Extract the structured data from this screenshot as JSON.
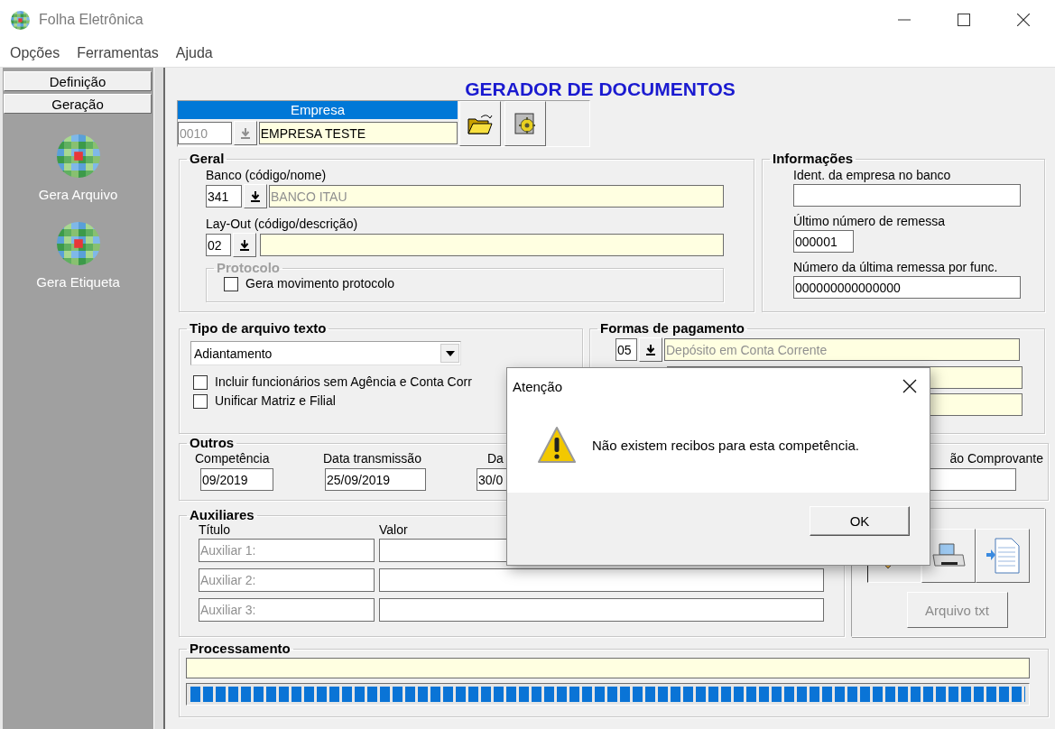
{
  "window": {
    "title": "Folha Eletrônica"
  },
  "menu": [
    {
      "label": "Opções"
    },
    {
      "label": "Ferramentas"
    },
    {
      "label": "Ajuda"
    }
  ],
  "sidebar": {
    "tabs": [
      {
        "label": "Definição"
      },
      {
        "label": "Geração"
      }
    ],
    "items": [
      {
        "label": "Gera Arquivo"
      },
      {
        "label": "Gera Etiqueta"
      }
    ]
  },
  "form": {
    "title": "GERADOR DE DOCUMENTOS",
    "empresa": {
      "label": "Empresa",
      "code": "0010",
      "name": "EMPRESA TESTE"
    },
    "geral": {
      "title": "Geral",
      "banco": {
        "label": "Banco (código/nome)",
        "code": "341",
        "name": "BANCO ITAU"
      },
      "layout": {
        "label": "Lay-Out (código/descrição)",
        "code": "02"
      },
      "protocolo": {
        "title": "Protocolo",
        "disabled": true,
        "option": {
          "label": "Gera movimento protocolo",
          "checked": false
        }
      }
    },
    "informacoes": {
      "title": "Informações",
      "fields": [
        {
          "label": "Ident. da empresa no banco"
        },
        {
          "label": "Último número de remessa",
          "value": "000001"
        },
        {
          "label": "Número da última remessa por func.",
          "value": "000000000000000"
        }
      ]
    },
    "tipo": {
      "title": "Tipo de arquivo texto",
      "select": "Adiantamento",
      "options": [
        {
          "label": "Incluir funcionários sem Agência e Conta Corr",
          "checked": false
        },
        {
          "label": "Unificar Matriz e Filial",
          "checked": false
        }
      ]
    },
    "formas": {
      "title": "Formas de pagamento",
      "rows": [
        {
          "code": "05",
          "description": "Depósito em Conta Corrente"
        },
        {
          "kind": "empty"
        },
        {
          "kind": "empty"
        }
      ]
    },
    "outros": {
      "title": "Outros",
      "fields": [
        {
          "label": "Competência",
          "value": "09/2019"
        },
        {
          "label": "Data transmissão",
          "value": "25/09/2019"
        },
        {
          "label": "Da",
          "value": "30/0"
        },
        {
          "label": "ão Comprovante"
        }
      ]
    },
    "auxiliares": {
      "title": "Auxiliares",
      "columns": [
        "Título",
        "Valor"
      ],
      "rows": [
        {
          "title": "Auxiliar 1:"
        },
        {
          "title": "Auxiliar 2:"
        },
        {
          "title": "Auxiliar 3:"
        }
      ]
    },
    "actions": {
      "export_button": {
        "label": "Arquivo txt",
        "disabled": true
      }
    },
    "processamento": {
      "title": "Processamento",
      "level": 1
    }
  },
  "dialog": {
    "title": "Atenção",
    "message": "Não existem recibos para esta competência.",
    "button": "OK"
  }
}
